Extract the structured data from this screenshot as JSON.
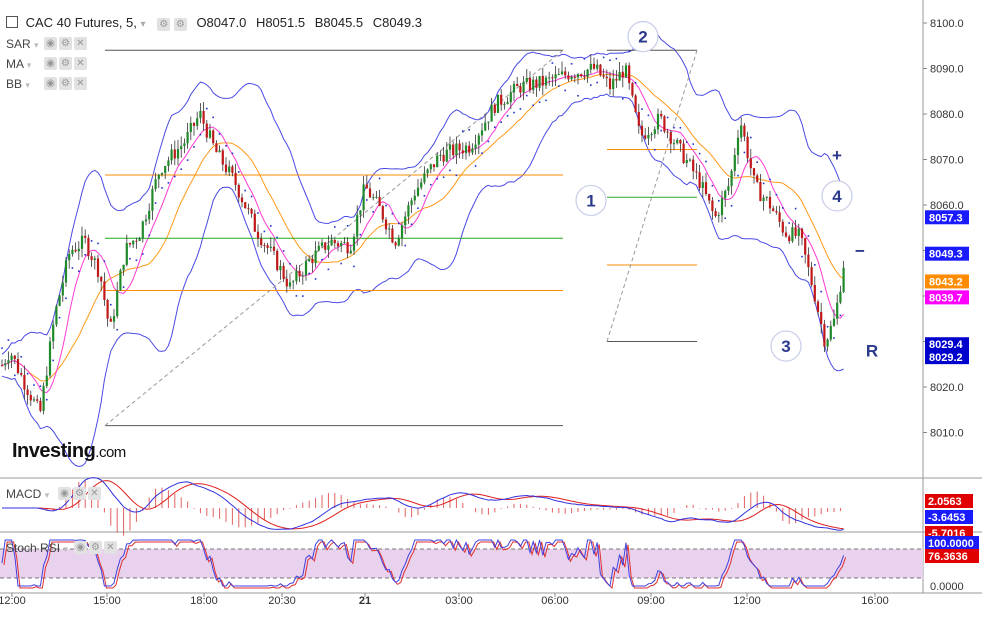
{
  "header": {
    "menu_icon": "menu-icon",
    "title": "CAC 40 Futures, 5,",
    "open": "O8047.0",
    "high": "H8051.5",
    "bid": "B8045.5",
    "close": "C8049.3"
  },
  "indicators": [
    "SAR",
    "MA",
    "BB"
  ],
  "logo": {
    "main": "Investing",
    "suffix": ".com"
  },
  "subpanels": {
    "macd_label": "MACD",
    "stoch_label": "Stoch RSI"
  },
  "chart_data": [
    {
      "type": "candlestick",
      "instrument": "CAC 40 Futures",
      "timeframe": "5",
      "x_ticks": [
        "12:00",
        "15:00",
        "18:00",
        "20:30",
        "21",
        "03:00",
        "06:00",
        "09:00",
        "12:00",
        "16:00"
      ],
      "y_ticks": [
        8010.0,
        8020.0,
        8030.0,
        8040.0,
        8050.0,
        8060.0,
        8070.0,
        8080.0,
        8090.0,
        8100.0
      ],
      "ylim": [
        8006,
        8102
      ],
      "price_path": [
        [
          0,
          8024
        ],
        [
          10,
          8028
        ],
        [
          20,
          8023
        ],
        [
          40,
          8014
        ],
        [
          55,
          8036
        ],
        [
          70,
          8050
        ],
        [
          85,
          8052
        ],
        [
          100,
          8045
        ],
        [
          110,
          8032
        ],
        [
          125,
          8050
        ],
        [
          140,
          8054
        ],
        [
          160,
          8068
        ],
        [
          185,
          8074
        ],
        [
          200,
          8080
        ],
        [
          215,
          8072
        ],
        [
          235,
          8065
        ],
        [
          255,
          8055
        ],
        [
          275,
          8048
        ],
        [
          290,
          8042
        ],
        [
          310,
          8048
        ],
        [
          330,
          8052
        ],
        [
          350,
          8051
        ],
        [
          365,
          8064
        ],
        [
          380,
          8059
        ],
        [
          395,
          8052
        ],
        [
          415,
          8063
        ],
        [
          440,
          8071
        ],
        [
          470,
          8073
        ],
        [
          495,
          8082
        ],
        [
          520,
          8086
        ],
        [
          545,
          8087
        ],
        [
          570,
          8089
        ],
        [
          595,
          8090
        ],
        [
          610,
          8086
        ],
        [
          625,
          8090
        ],
        [
          640,
          8075
        ],
        [
          660,
          8079
        ],
        [
          680,
          8072
        ],
        [
          700,
          8065
        ],
        [
          715,
          8057
        ],
        [
          730,
          8065
        ],
        [
          740,
          8079
        ],
        [
          755,
          8064
        ],
        [
          770,
          8060
        ],
        [
          785,
          8054
        ],
        [
          800,
          8053
        ],
        [
          815,
          8040
        ],
        [
          825,
          8030
        ],
        [
          835,
          8035
        ],
        [
          845,
          8049
        ]
      ],
      "current_price": 8049.3,
      "price_tags": [
        {
          "label": "8057.3",
          "value": 8057.3,
          "color": "#1a1aff"
        },
        {
          "label": "8049.3",
          "value": 8049.3,
          "color": "#1a1aff"
        },
        {
          "label": "8043.2",
          "value": 8043.2,
          "color": "#ff8c00"
        },
        {
          "label": "8039.7",
          "value": 8039.7,
          "color": "#ff00ff"
        },
        {
          "label": "8029.4",
          "value": 8029.4,
          "color": "#0000cc"
        },
        {
          "label": "8029.2",
          "value": 8029.2,
          "color": "#0000cc"
        }
      ],
      "fib_left": {
        "x_start": 105,
        "x_end": 563,
        "from": 8011.5,
        "to": 8094,
        "levels": [
          8094,
          8066.6,
          8052.7,
          8041.2,
          8011.5
        ]
      },
      "fib_right": {
        "x_start": 607,
        "x_end": 697,
        "from": 8030,
        "to": 8094,
        "levels": [
          8094,
          8072.2,
          8061.7,
          8046.8,
          8030
        ]
      },
      "wave_labels": [
        {
          "text": "1",
          "x": 591,
          "value": 8061
        },
        {
          "text": "2",
          "x": 643,
          "value": 8097
        },
        {
          "text": "3",
          "x": 786,
          "value": 8029
        },
        {
          "text": "4",
          "x": 837,
          "value": 8062
        },
        {
          "text": "+",
          "x": 837,
          "value": 8071
        },
        {
          "text": "−",
          "x": 860,
          "value": 8050
        },
        {
          "text": "R",
          "x": 872,
          "value": 8028
        }
      ]
    },
    {
      "type": "line",
      "name": "MACD",
      "value_tags": [
        {
          "label": "2.0563",
          "color": "#e00000"
        },
        {
          "label": "-3.6453",
          "color": "#1a1aff"
        },
        {
          "label": "-5.7016",
          "color": "#e00000"
        }
      ]
    },
    {
      "type": "line",
      "name": "Stoch RSI",
      "y_ticks": [
        "0.0000"
      ],
      "value_tags": [
        {
          "label": "100.0000",
          "color": "#1a1aff"
        },
        {
          "label": "76.3636",
          "color": "#e00000"
        }
      ]
    }
  ]
}
